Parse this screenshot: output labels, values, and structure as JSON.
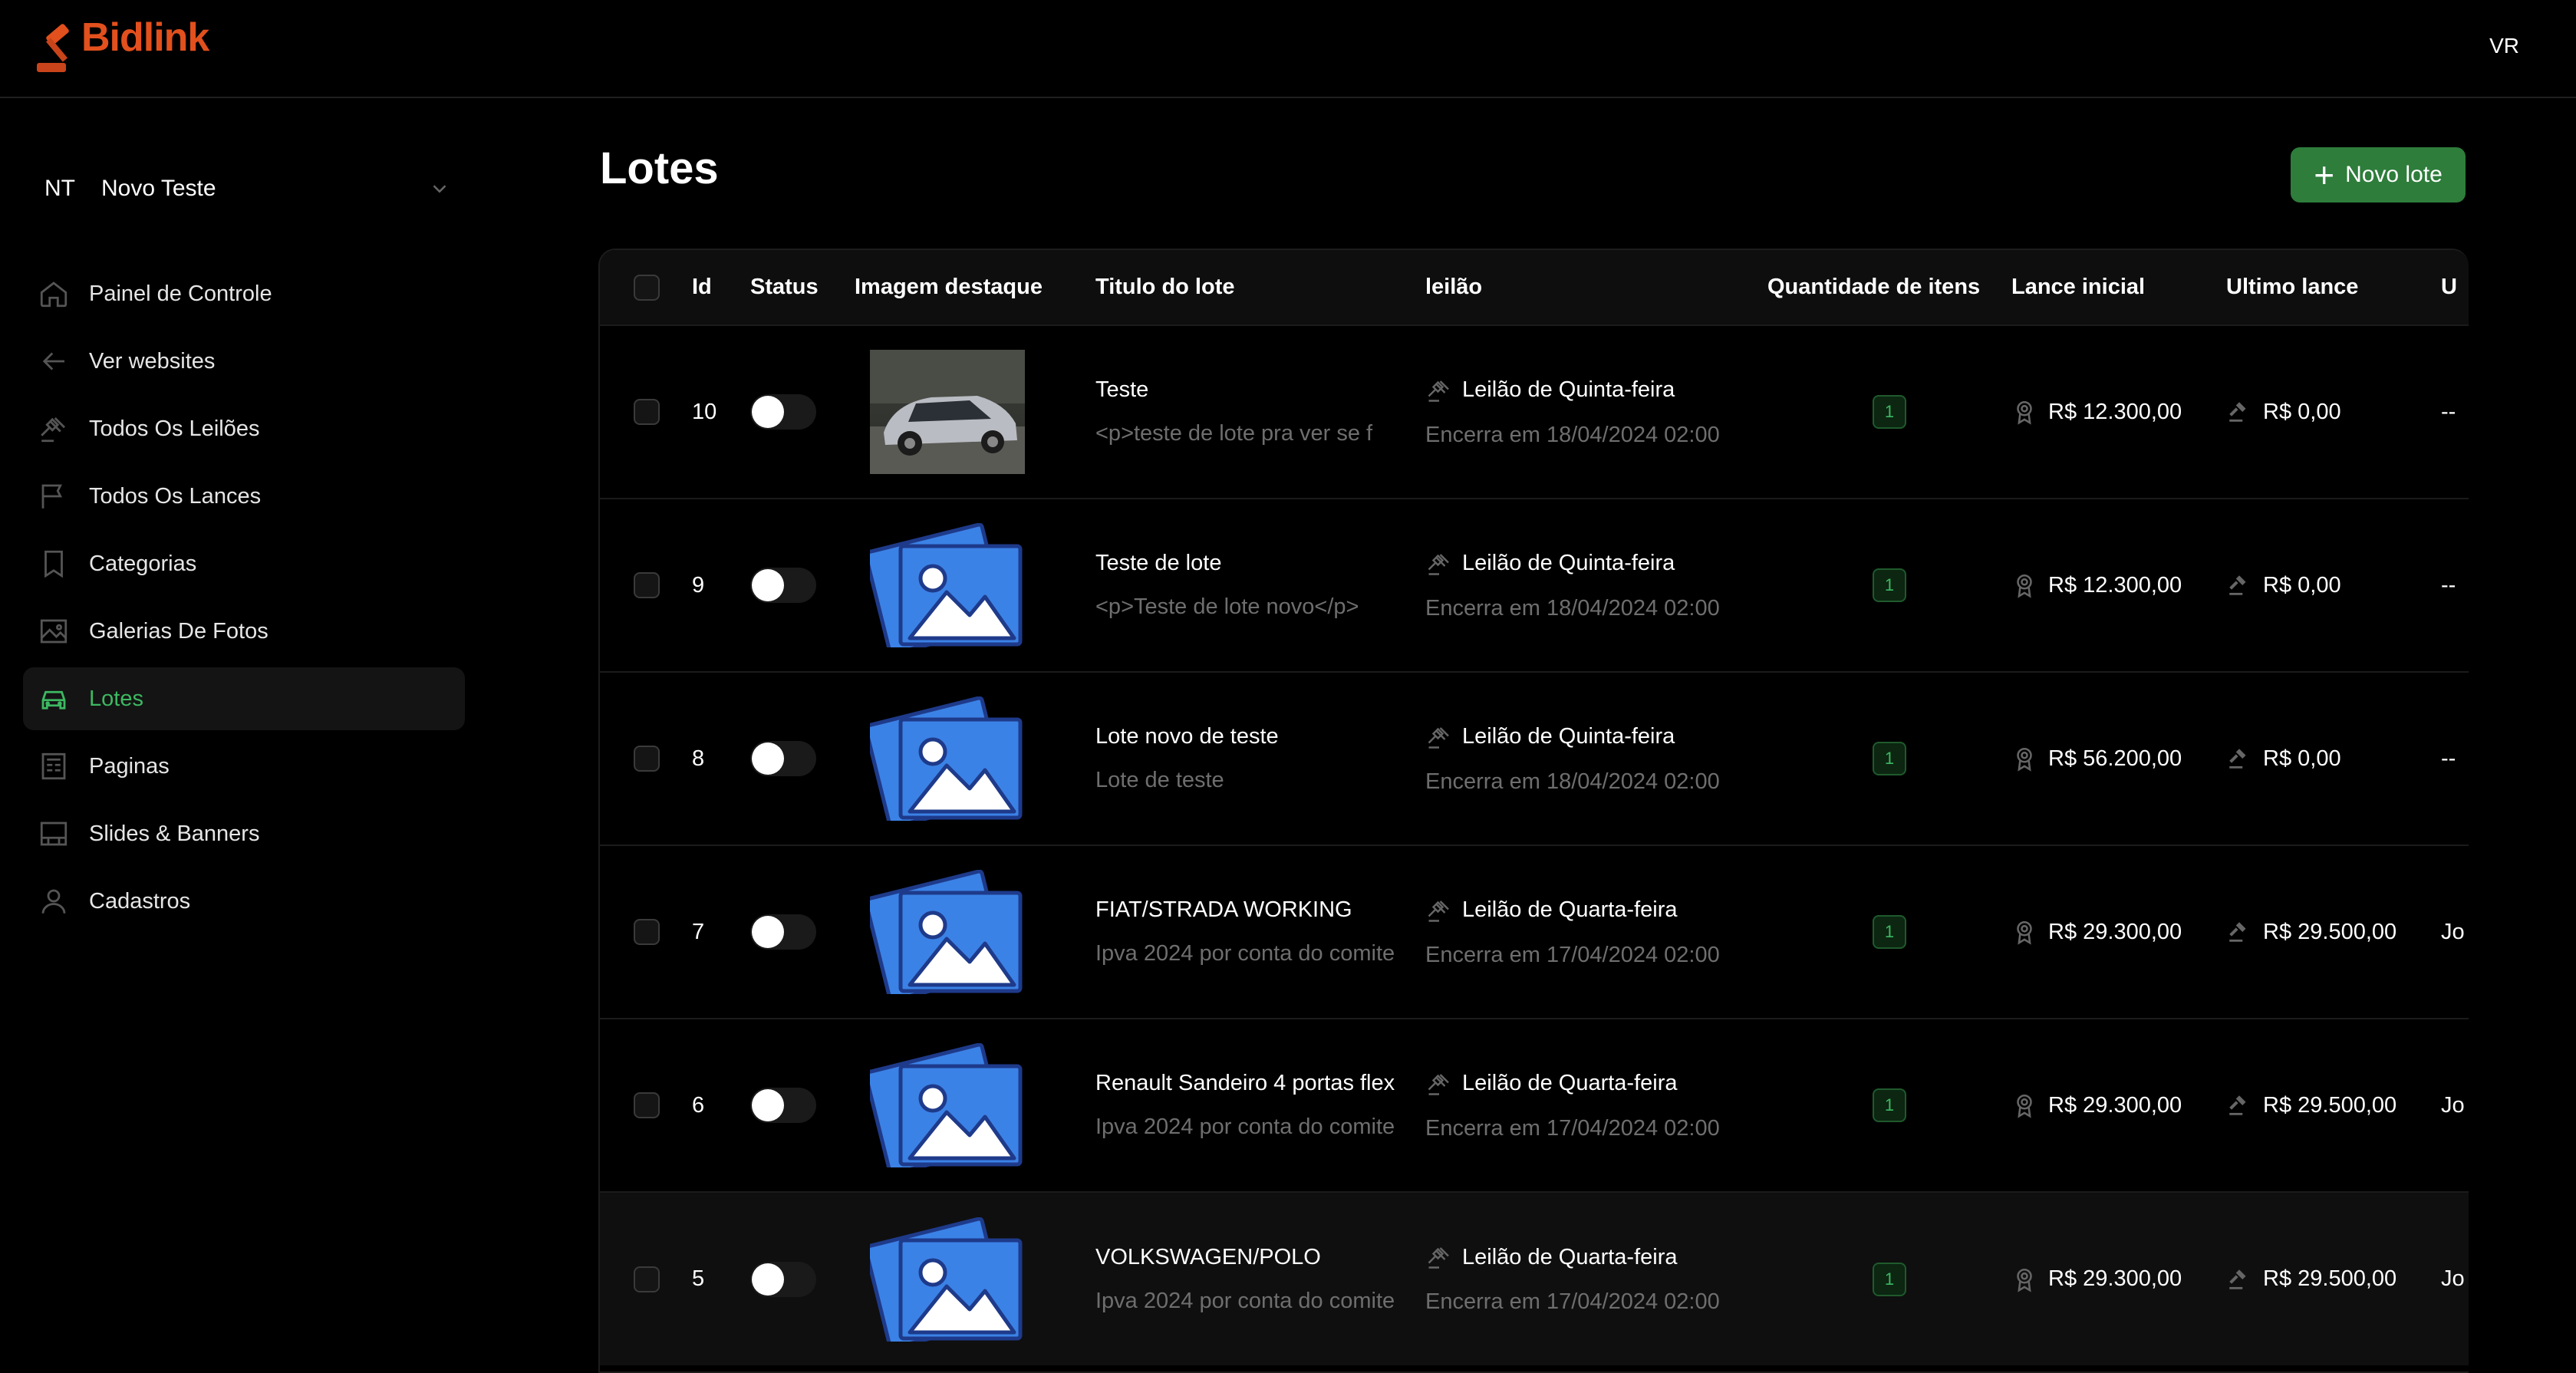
{
  "app": {
    "name": "Bidlink",
    "user_initials": "VR"
  },
  "org": {
    "abbr": "NT",
    "name": "Novo Teste"
  },
  "sidebar": {
    "items": [
      {
        "label": "Painel de Controle",
        "icon": "home-icon"
      },
      {
        "label": "Ver websites",
        "icon": "arrow-left-icon"
      },
      {
        "label": "Todos Os Leilões",
        "icon": "gavel-icon"
      },
      {
        "label": "Todos Os Lances",
        "icon": "flag-icon"
      },
      {
        "label": "Categorias",
        "icon": "bookmark-icon"
      },
      {
        "label": "Galerias De Fotos",
        "icon": "image-icon"
      },
      {
        "label": "Lotes",
        "icon": "car-icon",
        "active": true
      },
      {
        "label": "Paginas",
        "icon": "newspaper-icon"
      },
      {
        "label": "Slides & Banners",
        "icon": "slides-icon"
      },
      {
        "label": "Cadastros",
        "icon": "user-icon"
      }
    ]
  },
  "page": {
    "title": "Lotes",
    "new_button": "Novo lote"
  },
  "table": {
    "headers": {
      "id": "Id",
      "status": "Status",
      "image": "Imagem destaque",
      "title": "Titulo do lote",
      "auction": "leilão",
      "qty": "Quantidade de itens",
      "initial": "Lance inicial",
      "last": "Ultimo lance",
      "user": "U"
    },
    "rows": [
      {
        "id": "10",
        "image": "car-photo",
        "title": "Teste",
        "desc": "<p>teste de lote pra ver se f",
        "auction": "Leilão de Quinta-feira",
        "ends": "Encerra em 18/04/2024 02:00",
        "qty": "1",
        "initial": "R$ 12.300,00",
        "last": "R$ 0,00",
        "user": "--"
      },
      {
        "id": "9",
        "image": "placeholder",
        "title": "Teste de lote",
        "desc": "<p>Teste de lote novo</p>",
        "auction": "Leilão de Quinta-feira",
        "ends": "Encerra em 18/04/2024 02:00",
        "qty": "1",
        "initial": "R$ 12.300,00",
        "last": "R$ 0,00",
        "user": "--"
      },
      {
        "id": "8",
        "image": "placeholder",
        "title": "Lote novo de teste",
        "desc": "Lote de teste",
        "auction": "Leilão de Quinta-feira",
        "ends": "Encerra em 18/04/2024 02:00",
        "qty": "1",
        "initial": "R$ 56.200,00",
        "last": "R$ 0,00",
        "user": "--"
      },
      {
        "id": "7",
        "image": "placeholder",
        "title": "FIAT/STRADA WORKING",
        "desc": "Ipva 2024 por conta do comite",
        "auction": "Leilão de Quarta-feira",
        "ends": "Encerra em 17/04/2024 02:00",
        "qty": "1",
        "initial": "R$ 29.300,00",
        "last": "R$ 29.500,00",
        "user": "Jo"
      },
      {
        "id": "6",
        "image": "placeholder",
        "title": "Renault Sandeiro 4 portas flex",
        "desc": "Ipva 2024 por conta do comite",
        "auction": "Leilão de Quarta-feira",
        "ends": "Encerra em 17/04/2024 02:00",
        "qty": "1",
        "initial": "R$ 29.300,00",
        "last": "R$ 29.500,00",
        "user": "Jo"
      },
      {
        "id": "5",
        "image": "placeholder",
        "title": "VOLKSWAGEN/POLO",
        "desc": "Ipva 2024 por conta do comite",
        "auction": "Leilão de Quarta-feira",
        "ends": "Encerra em 17/04/2024 02:00",
        "qty": "1",
        "initial": "R$ 29.300,00",
        "last": "R$ 29.500,00",
        "user": "Jo",
        "highlighted": true
      }
    ]
  },
  "colors": {
    "accent_green": "#3db861",
    "button_green": "#2e7d3b",
    "brand_orange": "#e2501d",
    "placeholder_blue": "#3b82e6"
  }
}
